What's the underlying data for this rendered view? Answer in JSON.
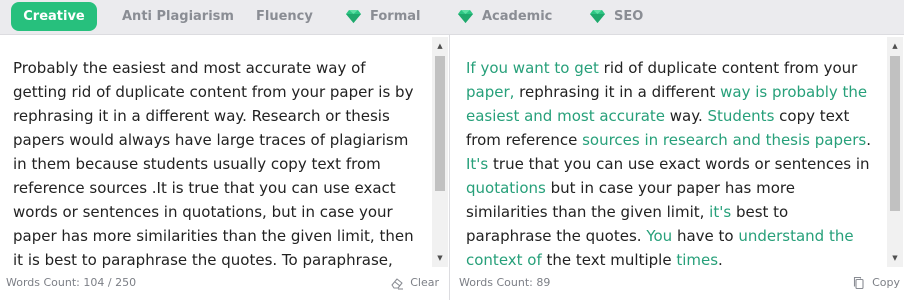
{
  "tabs": [
    {
      "label": "Creative",
      "active": true,
      "icon": ""
    },
    {
      "label": "Anti Plagiarism",
      "active": false,
      "icon": ""
    },
    {
      "label": "Fluency",
      "active": false,
      "icon": ""
    },
    {
      "label": "Formal",
      "active": false,
      "icon": "diamond-icon"
    },
    {
      "label": "Academic",
      "active": false,
      "icon": "diamond-icon"
    },
    {
      "label": "SEO",
      "active": false,
      "icon": "diamond-icon"
    }
  ],
  "colors": {
    "accent": "#27c07d",
    "highlight": "#27a07a",
    "premium_gem": "#2cc583"
  },
  "input_panel": {
    "text": "Probably the easiest and most accurate way of getting rid of duplicate content from your paper is by rephrasing it in a different way. Research or thesis papers would always have large traces of plagiarism in them because students usually copy text from reference sources .It is true that you can use exact words or sentences in quotations, but in case your paper has more similarities than the given limit, then it is best to paraphrase the quotes. To paraphrase, you have to read",
    "word_count": "Words Count: 104 / 250",
    "clear_label": "Clear"
  },
  "output_panel": {
    "segments": [
      {
        "text": "If you want to get",
        "changed": true
      },
      {
        "text": " rid of duplicate content from your ",
        "changed": false
      },
      {
        "text": "paper,",
        "changed": true
      },
      {
        "text": " rephrasing it in a different ",
        "changed": false
      },
      {
        "text": "way is probably the easiest and most accurate",
        "changed": true
      },
      {
        "text": " way. ",
        "changed": false
      },
      {
        "text": "Students",
        "changed": true
      },
      {
        "text": " copy text from reference ",
        "changed": false
      },
      {
        "text": "sources in research and thesis papers",
        "changed": true
      },
      {
        "text": ". ",
        "changed": false
      },
      {
        "text": "It's",
        "changed": true
      },
      {
        "text": " true that you can use exact words or sentences in ",
        "changed": false
      },
      {
        "text": "quotations",
        "changed": true
      },
      {
        "text": " but in case your paper has more similarities than the given limit, ",
        "changed": false
      },
      {
        "text": "it's",
        "changed": true
      },
      {
        "text": " best to paraphrase the quotes. ",
        "changed": false
      },
      {
        "text": "You",
        "changed": true
      },
      {
        "text": " have to ",
        "changed": false
      },
      {
        "text": "understand the context of",
        "changed": true
      },
      {
        "text": " the text multiple ",
        "changed": false
      },
      {
        "text": "times",
        "changed": true
      },
      {
        "text": ".",
        "changed": false
      }
    ],
    "word_count": "Words Count: 89",
    "copy_label": "Copy"
  }
}
